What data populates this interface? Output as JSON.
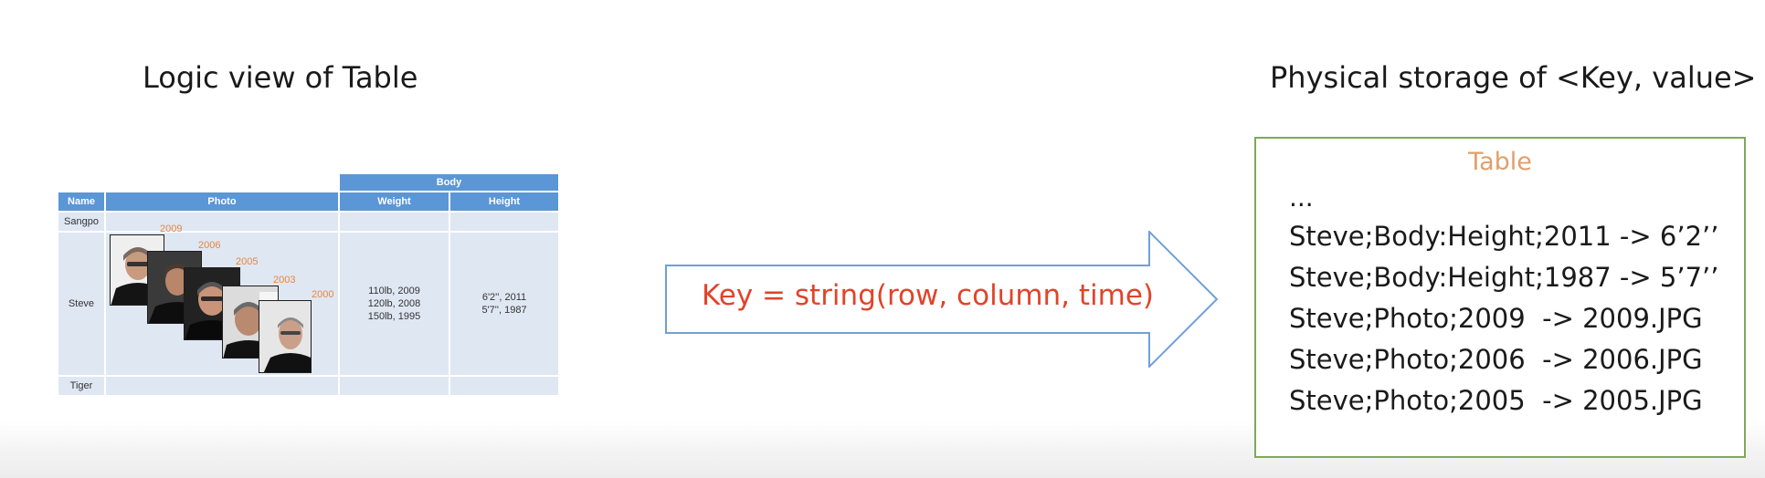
{
  "titles": {
    "left": "Logic view of Table",
    "right": "Physical storage of <Key, value>"
  },
  "logic_table": {
    "group_header": "Body",
    "headers": {
      "name": "Name",
      "photo": "Photo",
      "weight": "Weight",
      "height": "Height"
    },
    "rows": {
      "sangpo": "Sangpo",
      "steve": "Steve",
      "tiger": "Tiger"
    },
    "steve_weights": [
      "110lb, 2009",
      "120lb, 2008",
      "150lb, 1995"
    ],
    "steve_heights": [
      "6'2'', 2011",
      "5'7'', 1987"
    ],
    "photo_years": [
      "2009",
      "2006",
      "2005",
      "2003",
      "2000"
    ]
  },
  "arrow": {
    "label": "Key = string(row, column, time)"
  },
  "storage": {
    "title": "Table",
    "ellipsis": "...",
    "entries": [
      "Steve;Body:Height;2011 -> 6’2’’",
      "Steve;Body:Height;1987 -> 5’7’’",
      "Steve;Photo;2009  -> 2009.JPG",
      "Steve;Photo;2006  -> 2006.JPG",
      "Steve;Photo;2005  -> 2005.JPG"
    ]
  },
  "colors": {
    "header_blue": "#5b96d6",
    "row_fill": "#dfe7f3",
    "year_orange": "#e8863c",
    "key_red": "#e0442a",
    "arrow_stroke": "#6fa0d8",
    "box_green": "#7fa85a",
    "table_title_orange": "#e0a06a"
  },
  "icons": {
    "photo": "portrait-photo-icon"
  }
}
